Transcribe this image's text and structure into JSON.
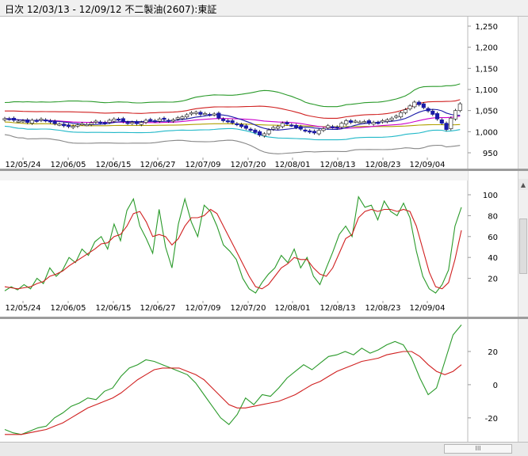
{
  "window": {
    "title": "日次 12/03/13 - 12/09/12    不二製油(2607):東証"
  },
  "x_ticks": [
    "12/05/24",
    "12/06/05",
    "12/06/15",
    "12/06/27",
    "12/07/09",
    "12/07/20",
    "12/08/01",
    "12/08/13",
    "12/08/23",
    "12/09/04"
  ],
  "panels": [
    {
      "name": "price",
      "y_ticks": [
        "1,250",
        "1,200",
        "1,150",
        "1,100",
        "1,050",
        "1,000",
        "950"
      ]
    },
    {
      "name": "stochastics",
      "y_ticks": [
        "100",
        "80",
        "60",
        "40",
        "20"
      ]
    },
    {
      "name": "macd",
      "y_ticks": [
        "20",
        "0",
        "-20"
      ]
    }
  ],
  "scroll": {
    "thumb_label": "III"
  },
  "chart_data": [
    {
      "type": "candlestick",
      "ylim": [
        950,
        1250
      ],
      "y_ticks": [
        1250,
        1200,
        1150,
        1100,
        1050,
        1000,
        950
      ],
      "grid": false,
      "colors": {
        "up": "#ffffff",
        "down": "#1a1aa8",
        "wick": "#000000"
      },
      "close": [
        1031,
        1030,
        1027,
        1025,
        1026,
        1022,
        1027,
        1025,
        1030,
        1026,
        1023,
        1019,
        1018,
        1014,
        1012,
        1013,
        1016,
        1019,
        1017,
        1021,
        1025,
        1022,
        1020,
        1027,
        1030,
        1029,
        1024,
        1020,
        1022,
        1019,
        1022,
        1027,
        1028,
        1025,
        1030,
        1029,
        1025,
        1028,
        1033,
        1035,
        1040,
        1045,
        1046,
        1041,
        1043,
        1040,
        1042,
        1032,
        1026,
        1024,
        1021,
        1017,
        1012,
        1008,
        1004,
        998,
        992,
        995,
        1004,
        1010,
        1012,
        1020,
        1018,
        1015,
        1010,
        1006,
        1002,
        999,
        997,
        1003,
        1007,
        1014,
        1011,
        1009,
        1020,
        1026,
        1022,
        1025,
        1023,
        1024,
        1020,
        1022,
        1021,
        1026,
        1028,
        1032,
        1037,
        1045,
        1052,
        1061,
        1070,
        1064,
        1057,
        1049,
        1041,
        1030,
        1020,
        1005,
        1032,
        1050,
        1066
      ],
      "series": [
        {
          "name": "MA-short",
          "color": "#1a1aa8"
        },
        {
          "name": "MA-mid",
          "color": "#cc00cc"
        },
        {
          "name": "MA-long",
          "color": "#b0a000"
        },
        {
          "name": "BB-upper2",
          "color": "#2a9a2a"
        },
        {
          "name": "BB-upper1",
          "color": "#d02020"
        },
        {
          "name": "BB-lower1",
          "color": "#20b8c8"
        },
        {
          "name": "BB-lower2",
          "color": "#888888"
        }
      ]
    },
    {
      "type": "line",
      "ylim": [
        0,
        100
      ],
      "y_ticks": [
        100,
        80,
        60,
        40,
        20
      ],
      "grid": false,
      "series": [
        {
          "name": "%K",
          "color": "#2a9a2a",
          "values": [
            8,
            12,
            9,
            14,
            10,
            20,
            15,
            30,
            22,
            28,
            40,
            35,
            48,
            42,
            55,
            60,
            48,
            72,
            56,
            85,
            96,
            70,
            58,
            44,
            86,
            50,
            30,
            72,
            96,
            74,
            60,
            90,
            84,
            70,
            52,
            46,
            38,
            20,
            10,
            6,
            16,
            24,
            30,
            42,
            35,
            48,
            30,
            40,
            22,
            14,
            30,
            45,
            62,
            70,
            60,
            98,
            88,
            90,
            76,
            94,
            84,
            80,
            92,
            78,
            46,
            22,
            10,
            6,
            14,
            28,
            70,
            88
          ]
        },
        {
          "name": "%D",
          "color": "#d02020",
          "values": [
            12,
            11,
            10,
            11,
            12,
            15,
            17,
            22,
            24,
            27,
            32,
            36,
            40,
            44,
            48,
            53,
            54,
            60,
            62,
            70,
            82,
            84,
            74,
            60,
            62,
            60,
            52,
            58,
            70,
            78,
            78,
            80,
            86,
            82,
            70,
            58,
            46,
            34,
            22,
            12,
            10,
            14,
            22,
            30,
            34,
            40,
            38,
            38,
            30,
            24,
            22,
            30,
            44,
            58,
            62,
            78,
            84,
            86,
            84,
            86,
            86,
            84,
            86,
            84,
            70,
            48,
            26,
            12,
            10,
            16,
            38,
            66
          ]
        }
      ]
    },
    {
      "type": "line",
      "ylim": [
        -32,
        30
      ],
      "y_ticks": [
        20,
        0,
        -20
      ],
      "grid": false,
      "series": [
        {
          "name": "MACD",
          "color": "#2a9a2a",
          "values": [
            -27,
            -29,
            -30,
            -28,
            -26,
            -25,
            -20,
            -17,
            -13,
            -11,
            -8,
            -9,
            -4,
            -2,
            5,
            10,
            12,
            15,
            14,
            12,
            10,
            8,
            6,
            1,
            -6,
            -13,
            -20,
            -24,
            -18,
            -8,
            -12,
            -6,
            -7,
            -2,
            4,
            8,
            12,
            9,
            13,
            17,
            18,
            20,
            18,
            22,
            19,
            21,
            24,
            26,
            24,
            16,
            4,
            -6,
            -2,
            14,
            30,
            36
          ]
        },
        {
          "name": "Signal",
          "color": "#d02020",
          "values": [
            -30,
            -30,
            -30,
            -29,
            -28,
            -27,
            -25,
            -23,
            -20,
            -17,
            -14,
            -12,
            -10,
            -8,
            -5,
            -1,
            3,
            6,
            9,
            10,
            10,
            10,
            8,
            6,
            3,
            -2,
            -7,
            -12,
            -14,
            -14,
            -13,
            -12,
            -11,
            -10,
            -8,
            -6,
            -3,
            0,
            2,
            5,
            8,
            10,
            12,
            14,
            15,
            16,
            18,
            19,
            20,
            20,
            17,
            12,
            8,
            6,
            8,
            12
          ]
        }
      ]
    }
  ]
}
